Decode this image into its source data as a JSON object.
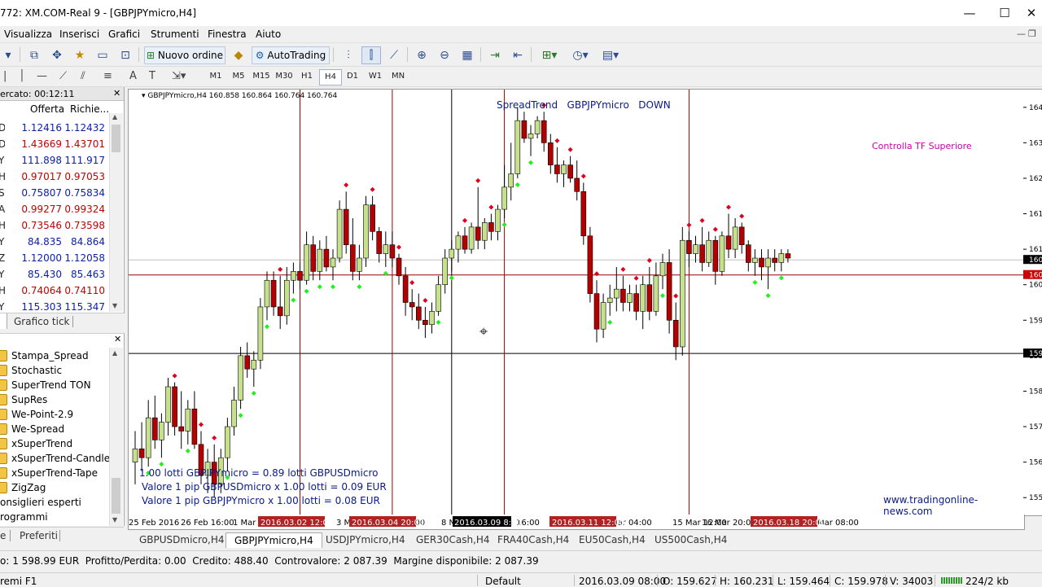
{
  "window": {
    "title": "772: XM.COM-Real 9 - [GBPJPYmicro,H4]",
    "controls": {
      "minimize": "—",
      "maximize": "☐",
      "close": "✕"
    }
  },
  "menu": {
    "items": [
      "Visualizza",
      "Inserisci",
      "Grafici",
      "Strumenti",
      "Finestra",
      "Aiuto"
    ],
    "mdi_controls": [
      "—",
      "❐",
      "✕"
    ]
  },
  "toolbar": {
    "new_order_label": "Nuovo ordine",
    "autotrading_label": "AutoTrading",
    "search_placeholder": ""
  },
  "timeframes": [
    "M1",
    "M5",
    "M15",
    "M30",
    "H1",
    "H4",
    "D1",
    "W1",
    "MN"
  ],
  "active_timeframe": "H4",
  "market_watch": {
    "header": "ercato: 00:12:11",
    "bid_header": "Offerta",
    "ask_header": "Richie...",
    "rows": [
      {
        "sym": "D",
        "bid": "1.12416",
        "ask": "1.12432",
        "dir": "up"
      },
      {
        "sym": "D",
        "bid": "1.43669",
        "ask": "1.43701",
        "dir": "down"
      },
      {
        "sym": "Y",
        "bid": "111.898",
        "ask": "111.917",
        "dir": "up"
      },
      {
        "sym": "HF",
        "bid": "0.97017",
        "ask": "0.97053",
        "dir": "down"
      },
      {
        "sym": "SD",
        "bid": "0.75807",
        "ask": "0.75834",
        "dir": "up"
      },
      {
        "sym": "AD",
        "bid": "0.99277",
        "ask": "0.99324",
        "dir": "down"
      },
      {
        "sym": "HF",
        "bid": "0.73546",
        "ask": "0.73598",
        "dir": "down"
      },
      {
        "sym": "Y",
        "bid": "84.835",
        "ask": "84.864",
        "dir": "up"
      },
      {
        "sym": "ZD",
        "bid": "1.12000",
        "ask": "1.12058",
        "dir": "up"
      },
      {
        "sym": "Y",
        "bid": "85.430",
        "ask": "85.463",
        "dir": "up"
      },
      {
        "sym": "HF",
        "bid": "0.74064",
        "ask": "0.74110",
        "dir": "down"
      },
      {
        "sym": "Y",
        "bid": "115.303",
        "ask": "115.347",
        "dir": "up"
      }
    ],
    "tab_label": "Grafico tick"
  },
  "navigator": {
    "items": [
      "Stampa_Spread",
      "Stochastic",
      "SuperTrend TON",
      "SupRes",
      "We-Point-2.9",
      "We-Spread",
      "xSuperTrend",
      "xSuperTrend-Candles",
      "xSuperTrend-Tape",
      "ZigZag"
    ],
    "sections": [
      "onsiglieri esperti",
      "rogrammi"
    ],
    "tab_label": "Preferiti",
    "tab_stub": "e"
  },
  "chart_data": {
    "type": "candlestick",
    "symbol_info": "GBPJPYmicro,H4  160.858 160.864 160.764 160.764",
    "indicator_title": "SpreadTrend   GBPJPYmicro   DOWN",
    "note": "Controlla TF Superiore",
    "website": "www.tradingonline-news.com",
    "info_lines": [
      "1.00 lotti GBPJPYmicro = 0.89 lotti GBPUSDmicro",
      "Valore 1 pip GBPUSDmicro x 1.00 lotti = 0.09 EUR",
      "Valore 1 pip GBPJPYmicro x 1.00 lotti = 0.08 EUR"
    ],
    "ylim": [
      155.0,
      164.6
    ],
    "y_ticks": [
      155.4,
      156.2,
      157.0,
      157.8,
      158.6,
      159.4,
      160.2,
      161.0,
      161.8,
      162.6,
      163.4,
      164.2
    ],
    "y_tick_labels": [
      "155",
      "156",
      "157",
      "158",
      "159",
      "159",
      "160",
      "161",
      "161",
      "162",
      "163",
      "164"
    ],
    "price_tags": [
      {
        "label": "160",
        "value": 160.76,
        "color": "#000000"
      },
      {
        "label": "160",
        "value": 160.42,
        "color": "#cc0000"
      },
      {
        "label": "159",
        "value": 158.65,
        "color": "#000000"
      }
    ],
    "x_labels": [
      "25 Feb 2016",
      "26 Feb 16:00",
      "1 Mar 0",
      "3 M",
      ":00",
      "8 N",
      "16:00",
      "14 Mar 04:00",
      "15 Mar 12:00",
      "16 Mar 20:00",
      "Mar 08:00"
    ],
    "x_highlight_labels": [
      "2016.03.02 12:00",
      "2016.03.04 20:00",
      "2016.03.11 12:00",
      "2016.03.18 20:00"
    ],
    "x_cursor_label": "2016.03.09 8:00",
    "hlines": [
      {
        "value": 160.76,
        "color": "#c0c0c0"
      },
      {
        "value": 160.42,
        "color": "#990000"
      },
      {
        "value": 158.65,
        "color": "#000000"
      }
    ],
    "candles": [
      {
        "o": 156.2,
        "h": 156.9,
        "l": 155.7,
        "c": 156.5
      },
      {
        "o": 156.5,
        "h": 157.1,
        "l": 156.0,
        "c": 156.3
      },
      {
        "o": 156.3,
        "h": 157.6,
        "l": 156.1,
        "c": 157.2
      },
      {
        "o": 157.2,
        "h": 157.7,
        "l": 156.5,
        "c": 156.7
      },
      {
        "o": 156.7,
        "h": 157.3,
        "l": 156.3,
        "c": 157.1
      },
      {
        "o": 157.1,
        "h": 158.1,
        "l": 156.8,
        "c": 157.9
      },
      {
        "o": 157.9,
        "h": 158.0,
        "l": 156.8,
        "c": 157.0
      },
      {
        "o": 157.0,
        "h": 157.8,
        "l": 156.5,
        "c": 156.9
      },
      {
        "o": 156.9,
        "h": 157.6,
        "l": 156.6,
        "c": 157.4
      },
      {
        "o": 157.4,
        "h": 157.8,
        "l": 156.5,
        "c": 156.6
      },
      {
        "o": 156.6,
        "h": 156.9,
        "l": 155.7,
        "c": 155.9
      },
      {
        "o": 155.9,
        "h": 156.5,
        "l": 155.5,
        "c": 156.2
      },
      {
        "o": 156.2,
        "h": 156.6,
        "l": 155.4,
        "c": 155.7
      },
      {
        "o": 155.7,
        "h": 156.5,
        "l": 155.5,
        "c": 156.3
      },
      {
        "o": 156.3,
        "h": 157.2,
        "l": 156.0,
        "c": 157.0
      },
      {
        "o": 157.0,
        "h": 157.9,
        "l": 156.8,
        "c": 157.6
      },
      {
        "o": 157.6,
        "h": 158.8,
        "l": 157.4,
        "c": 158.6
      },
      {
        "o": 158.6,
        "h": 158.9,
        "l": 158.1,
        "c": 158.3
      },
      {
        "o": 158.3,
        "h": 158.7,
        "l": 157.9,
        "c": 158.5
      },
      {
        "o": 158.5,
        "h": 159.9,
        "l": 158.3,
        "c": 159.7
      },
      {
        "o": 159.7,
        "h": 160.5,
        "l": 159.4,
        "c": 160.3
      },
      {
        "o": 160.3,
        "h": 160.5,
        "l": 159.5,
        "c": 159.7
      },
      {
        "o": 159.7,
        "h": 160.4,
        "l": 159.2,
        "c": 159.5
      },
      {
        "o": 159.5,
        "h": 160.6,
        "l": 159.3,
        "c": 160.3
      },
      {
        "o": 160.3,
        "h": 160.7,
        "l": 160.0,
        "c": 160.5
      },
      {
        "o": 160.5,
        "h": 160.7,
        "l": 160.1,
        "c": 160.3
      },
      {
        "o": 160.3,
        "h": 161.4,
        "l": 160.2,
        "c": 161.1
      },
      {
        "o": 161.1,
        "h": 161.3,
        "l": 160.3,
        "c": 160.5
      },
      {
        "o": 160.5,
        "h": 161.2,
        "l": 160.3,
        "c": 161.0
      },
      {
        "o": 161.0,
        "h": 161.3,
        "l": 160.5,
        "c": 160.6
      },
      {
        "o": 160.6,
        "h": 161.0,
        "l": 160.3,
        "c": 160.8
      },
      {
        "o": 160.8,
        "h": 162.1,
        "l": 160.7,
        "c": 161.9
      },
      {
        "o": 161.9,
        "h": 162.3,
        "l": 160.9,
        "c": 161.1
      },
      {
        "o": 161.1,
        "h": 161.7,
        "l": 160.3,
        "c": 160.5
      },
      {
        "o": 160.5,
        "h": 161.1,
        "l": 160.3,
        "c": 160.8
      },
      {
        "o": 160.8,
        "h": 162.2,
        "l": 160.6,
        "c": 162.0
      },
      {
        "o": 162.0,
        "h": 162.2,
        "l": 161.2,
        "c": 161.4
      },
      {
        "o": 161.4,
        "h": 161.5,
        "l": 160.7,
        "c": 160.9
      },
      {
        "o": 160.9,
        "h": 161.4,
        "l": 160.6,
        "c": 161.1
      },
      {
        "o": 161.1,
        "h": 161.4,
        "l": 160.6,
        "c": 160.8
      },
      {
        "o": 160.8,
        "h": 160.9,
        "l": 160.2,
        "c": 160.4
      },
      {
        "o": 160.4,
        "h": 160.6,
        "l": 159.5,
        "c": 159.8
      },
      {
        "o": 159.8,
        "h": 160.1,
        "l": 159.4,
        "c": 159.7
      },
      {
        "o": 159.7,
        "h": 160.0,
        "l": 159.2,
        "c": 159.4
      },
      {
        "o": 159.4,
        "h": 159.7,
        "l": 159.0,
        "c": 159.3
      },
      {
        "o": 159.3,
        "h": 159.8,
        "l": 159.1,
        "c": 159.6
      },
      {
        "o": 159.6,
        "h": 160.4,
        "l": 159.5,
        "c": 160.2
      },
      {
        "o": 160.2,
        "h": 161.0,
        "l": 160.0,
        "c": 160.8
      },
      {
        "o": 160.8,
        "h": 161.2,
        "l": 160.5,
        "c": 161.0
      },
      {
        "o": 161.0,
        "h": 161.4,
        "l": 160.7,
        "c": 161.3
      },
      {
        "o": 161.3,
        "h": 161.5,
        "l": 160.9,
        "c": 161.0
      },
      {
        "o": 161.0,
        "h": 161.6,
        "l": 160.9,
        "c": 161.5
      },
      {
        "o": 161.5,
        "h": 162.4,
        "l": 161.0,
        "c": 161.2
      },
      {
        "o": 161.2,
        "h": 161.7,
        "l": 161.0,
        "c": 161.6
      },
      {
        "o": 161.6,
        "h": 161.8,
        "l": 161.2,
        "c": 161.4
      },
      {
        "o": 161.4,
        "h": 162.0,
        "l": 161.2,
        "c": 161.9
      },
      {
        "o": 161.9,
        "h": 162.9,
        "l": 161.7,
        "c": 162.4
      },
      {
        "o": 162.4,
        "h": 163.4,
        "l": 162.1,
        "c": 162.7
      },
      {
        "o": 162.7,
        "h": 164.2,
        "l": 162.6,
        "c": 163.9
      },
      {
        "o": 163.9,
        "h": 164.1,
        "l": 163.4,
        "c": 163.5
      },
      {
        "o": 163.5,
        "h": 163.8,
        "l": 163.1,
        "c": 163.6
      },
      {
        "o": 163.6,
        "h": 164.0,
        "l": 163.5,
        "c": 163.9
      },
      {
        "o": 163.9,
        "h": 164.1,
        "l": 163.2,
        "c": 163.4
      },
      {
        "o": 163.4,
        "h": 163.6,
        "l": 162.7,
        "c": 162.9
      },
      {
        "o": 162.9,
        "h": 163.3,
        "l": 162.5,
        "c": 162.7
      },
      {
        "o": 162.7,
        "h": 163.0,
        "l": 162.4,
        "c": 162.9
      },
      {
        "o": 162.9,
        "h": 163.1,
        "l": 162.5,
        "c": 162.6
      },
      {
        "o": 162.6,
        "h": 163.0,
        "l": 162.1,
        "c": 162.3
      },
      {
        "o": 162.3,
        "h": 162.5,
        "l": 161.1,
        "c": 161.3
      },
      {
        "o": 161.3,
        "h": 161.5,
        "l": 159.8,
        "c": 160.0
      },
      {
        "o": 160.0,
        "h": 160.3,
        "l": 158.9,
        "c": 159.2
      },
      {
        "o": 159.2,
        "h": 160.0,
        "l": 159.0,
        "c": 159.8
      },
      {
        "o": 159.8,
        "h": 160.2,
        "l": 159.5,
        "c": 159.9
      },
      {
        "o": 159.9,
        "h": 160.6,
        "l": 159.6,
        "c": 160.1
      },
      {
        "o": 160.1,
        "h": 160.4,
        "l": 159.6,
        "c": 159.8
      },
      {
        "o": 159.8,
        "h": 160.2,
        "l": 159.6,
        "c": 160.0
      },
      {
        "o": 160.0,
        "h": 160.2,
        "l": 159.4,
        "c": 159.6
      },
      {
        "o": 159.6,
        "h": 160.4,
        "l": 159.2,
        "c": 160.2
      },
      {
        "o": 160.2,
        "h": 160.6,
        "l": 159.4,
        "c": 159.6
      },
      {
        "o": 159.6,
        "h": 160.7,
        "l": 159.5,
        "c": 160.4
      },
      {
        "o": 160.4,
        "h": 160.9,
        "l": 160.1,
        "c": 160.7
      },
      {
        "o": 160.7,
        "h": 161.0,
        "l": 159.1,
        "c": 159.4
      },
      {
        "o": 159.4,
        "h": 159.8,
        "l": 158.5,
        "c": 158.8
      },
      {
        "o": 158.8,
        "h": 161.5,
        "l": 158.6,
        "c": 161.2
      },
      {
        "o": 161.2,
        "h": 161.4,
        "l": 160.6,
        "c": 160.9
      },
      {
        "o": 160.9,
        "h": 161.3,
        "l": 160.7,
        "c": 161.1
      },
      {
        "o": 161.1,
        "h": 161.5,
        "l": 160.5,
        "c": 160.7
      },
      {
        "o": 160.7,
        "h": 161.4,
        "l": 160.6,
        "c": 161.2
      },
      {
        "o": 161.2,
        "h": 161.3,
        "l": 160.2,
        "c": 160.5
      },
      {
        "o": 160.5,
        "h": 161.4,
        "l": 160.4,
        "c": 161.3
      },
      {
        "o": 161.3,
        "h": 161.8,
        "l": 160.8,
        "c": 161.0
      },
      {
        "o": 161.0,
        "h": 161.7,
        "l": 160.8,
        "c": 161.5
      },
      {
        "o": 161.5,
        "h": 161.6,
        "l": 160.9,
        "c": 161.1
      },
      {
        "o": 161.1,
        "h": 161.2,
        "l": 160.5,
        "c": 160.7
      },
      {
        "o": 160.7,
        "h": 161.0,
        "l": 160.4,
        "c": 160.8
      },
      {
        "o": 160.8,
        "h": 161.0,
        "l": 160.3,
        "c": 160.6
      },
      {
        "o": 160.6,
        "h": 161.0,
        "l": 160.1,
        "c": 160.8
      },
      {
        "o": 160.8,
        "h": 161.0,
        "l": 160.5,
        "c": 160.7
      },
      {
        "o": 160.7,
        "h": 161.0,
        "l": 160.5,
        "c": 160.9
      },
      {
        "o": 160.9,
        "h": 161.0,
        "l": 160.7,
        "c": 160.8
      }
    ],
    "vlines": [
      {
        "at_candle": 25,
        "color": "#990000"
      },
      {
        "at_candle": 39,
        "color": "#990000"
      },
      {
        "at_candle": 48,
        "color": "#000000"
      },
      {
        "at_candle": 56,
        "color": "#990000"
      },
      {
        "at_candle": 84,
        "color": "#990000"
      }
    ],
    "colors": {
      "bull_body": "#c6e08c",
      "bear_body": "#b30000",
      "wick": "#000000",
      "up_marker": "#22ee22",
      "down_marker": "#e0001a",
      "title": "#0a1a8a",
      "note": "#cc00aa",
      "info": "#0a1a8a"
    }
  },
  "chart_tabs": [
    "GBPUSDmicro,H4",
    "GBPJPYmicro,H4",
    "USDJPYmicro,H4",
    "GER30Cash,H4",
    "FRA40Cash,H4",
    "EU50Cash,H4",
    "US500Cash,H4"
  ],
  "active_chart_tab": "GBPJPYmicro,H4",
  "terminal": {
    "summary": "o: 1 598.99 EUR  Profitto/Perdita: 0.00  Credito: 488.40  Controvalore: 2 087.39  Margine disponibile: 2 087.39"
  },
  "statusbar": {
    "help": "remi F1",
    "profile": "Default",
    "time": "2016.03.09 08:00",
    "open": "O: 159.627",
    "high": "H: 160.231",
    "low": "L: 159.464",
    "close": "C: 159.978",
    "volume": "V: 34003",
    "traffic": "224/2 kb"
  }
}
